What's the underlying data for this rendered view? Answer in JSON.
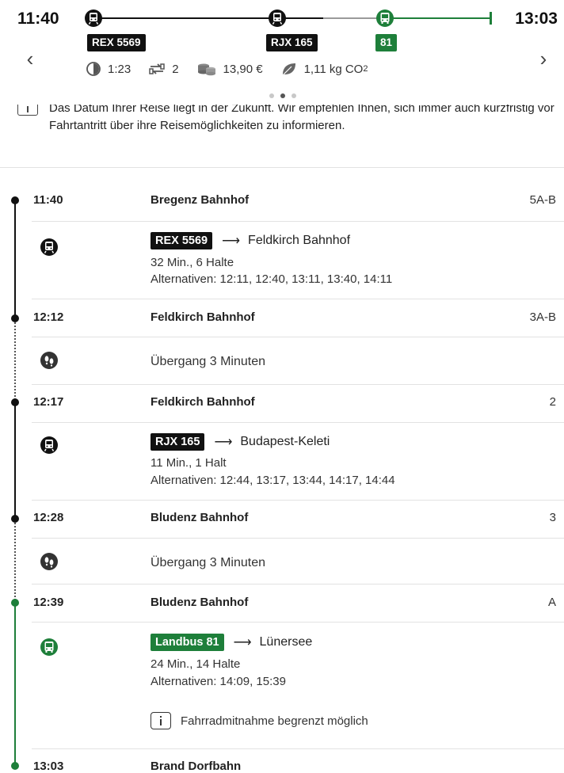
{
  "header": {
    "departure_time": "11:40",
    "arrival_time": "13:03",
    "legs": [
      {
        "badge": "REX 5569",
        "mode": "train-icon"
      },
      {
        "badge": "RJX 165",
        "mode": "train-icon"
      },
      {
        "badge": "81",
        "mode": "bus-icon"
      }
    ],
    "stats": {
      "duration": "1:23",
      "changes": "2",
      "price": "13,90 €",
      "co2_value": "1,11 kg CO",
      "co2_sub": "2"
    },
    "page_dots": {
      "total": 3,
      "active_index": 1
    },
    "prev_label": "‹",
    "next_label": "›"
  },
  "note": {
    "text": "Das Datum Ihrer Reise liegt in der Zukunft. Wir empfehlen Ihnen, sich immer auch kurzfristig vor Fahrtantritt über ihre Reisemöglichkeiten zu informieren."
  },
  "itinerary": {
    "stops": [
      {
        "time": "11:40",
        "name": "Bregenz Bahnhof",
        "platform": "5A-B"
      },
      {
        "time": "12:12",
        "name": "Feldkirch Bahnhof",
        "platform": "3A-B"
      },
      {
        "time": "12:17",
        "name": "Feldkirch Bahnhof",
        "platform": "2"
      },
      {
        "time": "12:28",
        "name": "Bludenz Bahnhof",
        "platform": "3"
      },
      {
        "time": "12:39",
        "name": "Bludenz Bahnhof",
        "platform": "A"
      },
      {
        "time": "13:03",
        "name": "Brand Dorfbahn",
        "platform": ""
      }
    ],
    "legs": [
      {
        "badge": "REX 5569",
        "arrow": "⟶",
        "destination": "Feldkirch Bahnhof",
        "summary": "32 Min., 6 Halte",
        "alternatives": "Alternativen: 12:11, 12:40, 13:11, 13:40, 14:11"
      },
      {
        "badge": "RJX 165",
        "arrow": "⟶",
        "destination": "Budapest-Keleti",
        "summary": "11 Min., 1 Halt",
        "alternatives": "Alternativen: 12:44, 13:17, 13:44, 14:17, 14:44"
      },
      {
        "badge": "Landbus 81",
        "arrow": "⟶",
        "destination": "Lünersee",
        "summary": "24 Min., 14 Halte",
        "alternatives": "Alternativen: 14:09, 15:39",
        "note": "Fahrradmitnahme begrenzt möglich"
      }
    ],
    "transfers": [
      {
        "text": "Übergang 3 Minuten"
      },
      {
        "text": "Übergang 3 Minuten"
      }
    ]
  },
  "colors": {
    "green": "#1e7f3a",
    "black": "#111111",
    "divider": "#e2e2e2"
  }
}
